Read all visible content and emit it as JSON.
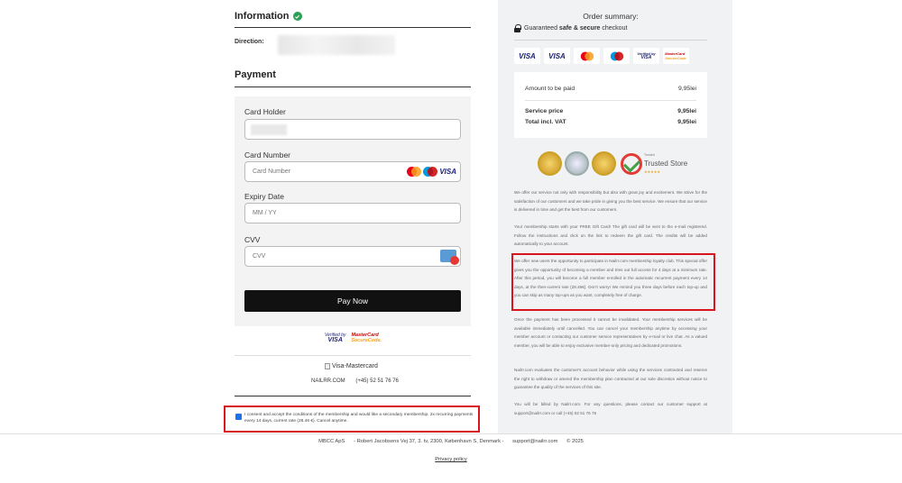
{
  "information": {
    "title": "Information",
    "direction_label": "Direction:"
  },
  "payment": {
    "title": "Payment",
    "card_holder_label": "Card Holder",
    "card_number_label": "Card Number",
    "card_number_placeholder": "Card Number",
    "expiry_label": "Expiry Date",
    "expiry_placeholder": "MM / YY",
    "cvv_label": "CVV",
    "cvv_placeholder": "CVV",
    "pay_button": "Pay Now",
    "card_brand_visa": "VISA"
  },
  "security_logos": {
    "verified_by": "Verified by",
    "visa": "VISA",
    "mastercard": "MasterCard",
    "securecode": "SecureCode."
  },
  "visa_mastercard_alt": "Visa-Mastercard",
  "contact": {
    "brand": "NAILRR.COM",
    "phone": "(+45) 52 51 76 76"
  },
  "consent": {
    "checked": true,
    "text": "I consent and accept the conditions of the membership and would like a secondary membership. 2x recurring payments every 14 days, current rate (28.46 €). Cancel anytime."
  },
  "order_summary": {
    "title": "Order summary:",
    "guaranteed_prefix": "Guaranteed ",
    "guaranteed_bold": "safe & secure",
    "guaranteed_suffix": " checkout",
    "payment_logos": [
      "VISA",
      "VISA"
    ],
    "amount_label": "Amount to be paid",
    "amount_value": "9,95lei",
    "service_label": "Service price",
    "service_value": "9,95lei",
    "total_label": "Total incl. VAT",
    "total_value": "9,95lei",
    "trusted_small": "Trusted",
    "trusted_store": "Trusted Store",
    "trusted_stars": "★★★★★"
  },
  "paragraphs": {
    "p1": "We offer our service not only with responsibility but also with great joy and excitement. We strive for the satisfaction of our customers and we take pride in giving you the best service. We ensure that our service is delivered in time and get the best from our customers.",
    "p2": "Your membership starts with your FREE Gift Card! The gift card will be sent to the e-mail registered. Follow the instructions and click on the link to redeem the gift card. The credits will be added automatically to your account.",
    "p3": "We offer new users the opportunity to participate in Nailrr.com membership loyalty club. This special offer gives you the opportunity of becoming a member and tries out full access for 4 days at a minimum rate. After this period, you will become a full member enrolled in the automatic recurrent payment every 14 days, at the then-current rate (28.46€). Don't worry! We remind you three days before each top-up and you can skip as many top-ups as you want, completely free of charge.",
    "p4": "Once the payment has been processed it cannot be invalidated. Your membership services will be available immediately until cancelled. You can cancel your membership anytime by accessing your member account or contacting our customer service representatives by e-mail or live chat. As a valued member, you will be able to enjoy exclusive member-only pricing and dedicated promotions.",
    "p5": "Nailrr.com evaluates the customer's account behavior while using the services contracted and reserve the right to withdraw or amend the membership plan contracted at our sole discretion without notice to guarantee the quality of the services of this site.",
    "p6": "You will be billed by Nailrr.com. For any questions, please contact our customer support at support@nailrr.com or call (+45) 52 51 76 76"
  },
  "footer": {
    "company": "MBCC ApS",
    "address": "- Robert Jacobsens Vej 37, 3. tv, 2300, København S, Denmark -",
    "email": "support@nailrr.com",
    "copyright": "© 2025",
    "privacy": "Privacy policy"
  },
  "colors": {
    "highlight_border": "#d8151f",
    "pay_button": "#111111",
    "check_green": "#2e9e55"
  }
}
